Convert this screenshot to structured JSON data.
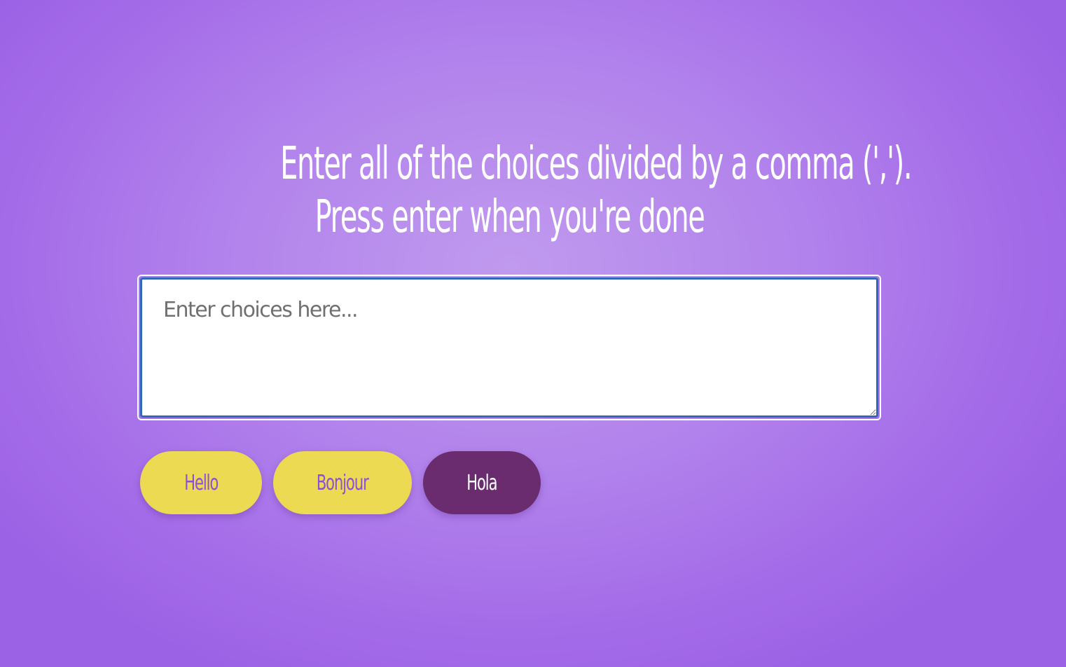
{
  "heading": {
    "line1": "Enter all of the choices divided by a comma (',').",
    "line2": "Press enter when you're done"
  },
  "choices_input": {
    "value": "",
    "placeholder": "Enter choices here..."
  },
  "choices": [
    {
      "label": "Hello",
      "style": "yellow"
    },
    {
      "label": "Bonjour",
      "style": "yellow"
    },
    {
      "label": "Hola",
      "style": "highlighted"
    }
  ],
  "colors": {
    "background": "#a46be8",
    "chip_yellow": "#ecda52",
    "chip_yellow_text": "#8d4ed8",
    "chip_highlight": "#6a2c6e",
    "input_border": "#2f6ab8"
  }
}
